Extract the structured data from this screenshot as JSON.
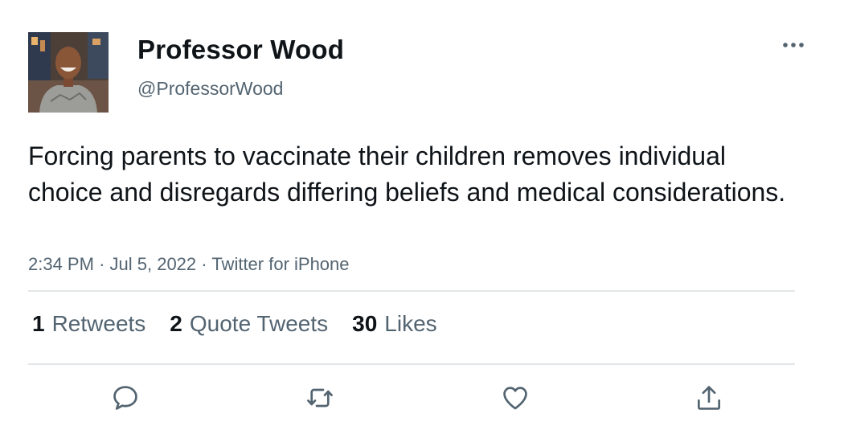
{
  "tweet": {
    "author": {
      "display_name": "Professor Wood",
      "handle": "@ProfessorWood"
    },
    "text": "Forcing parents to vaccinate their children removes individual choice and disregards differing beliefs and medical considerations.",
    "time": "2:34 PM",
    "separator": "·",
    "date": "Jul 5, 2022",
    "source": "Twitter for iPhone",
    "stats": [
      {
        "count": "1",
        "label": "Retweets"
      },
      {
        "count": "2",
        "label": "Quote Tweets"
      },
      {
        "count": "30",
        "label": "Likes"
      }
    ],
    "actions": [
      "reply-icon",
      "retweet-icon",
      "like-icon",
      "share-icon"
    ]
  },
  "colors": {
    "text_primary": "#0f1419",
    "text_secondary": "#536471",
    "divider": "#e3e6e8"
  }
}
